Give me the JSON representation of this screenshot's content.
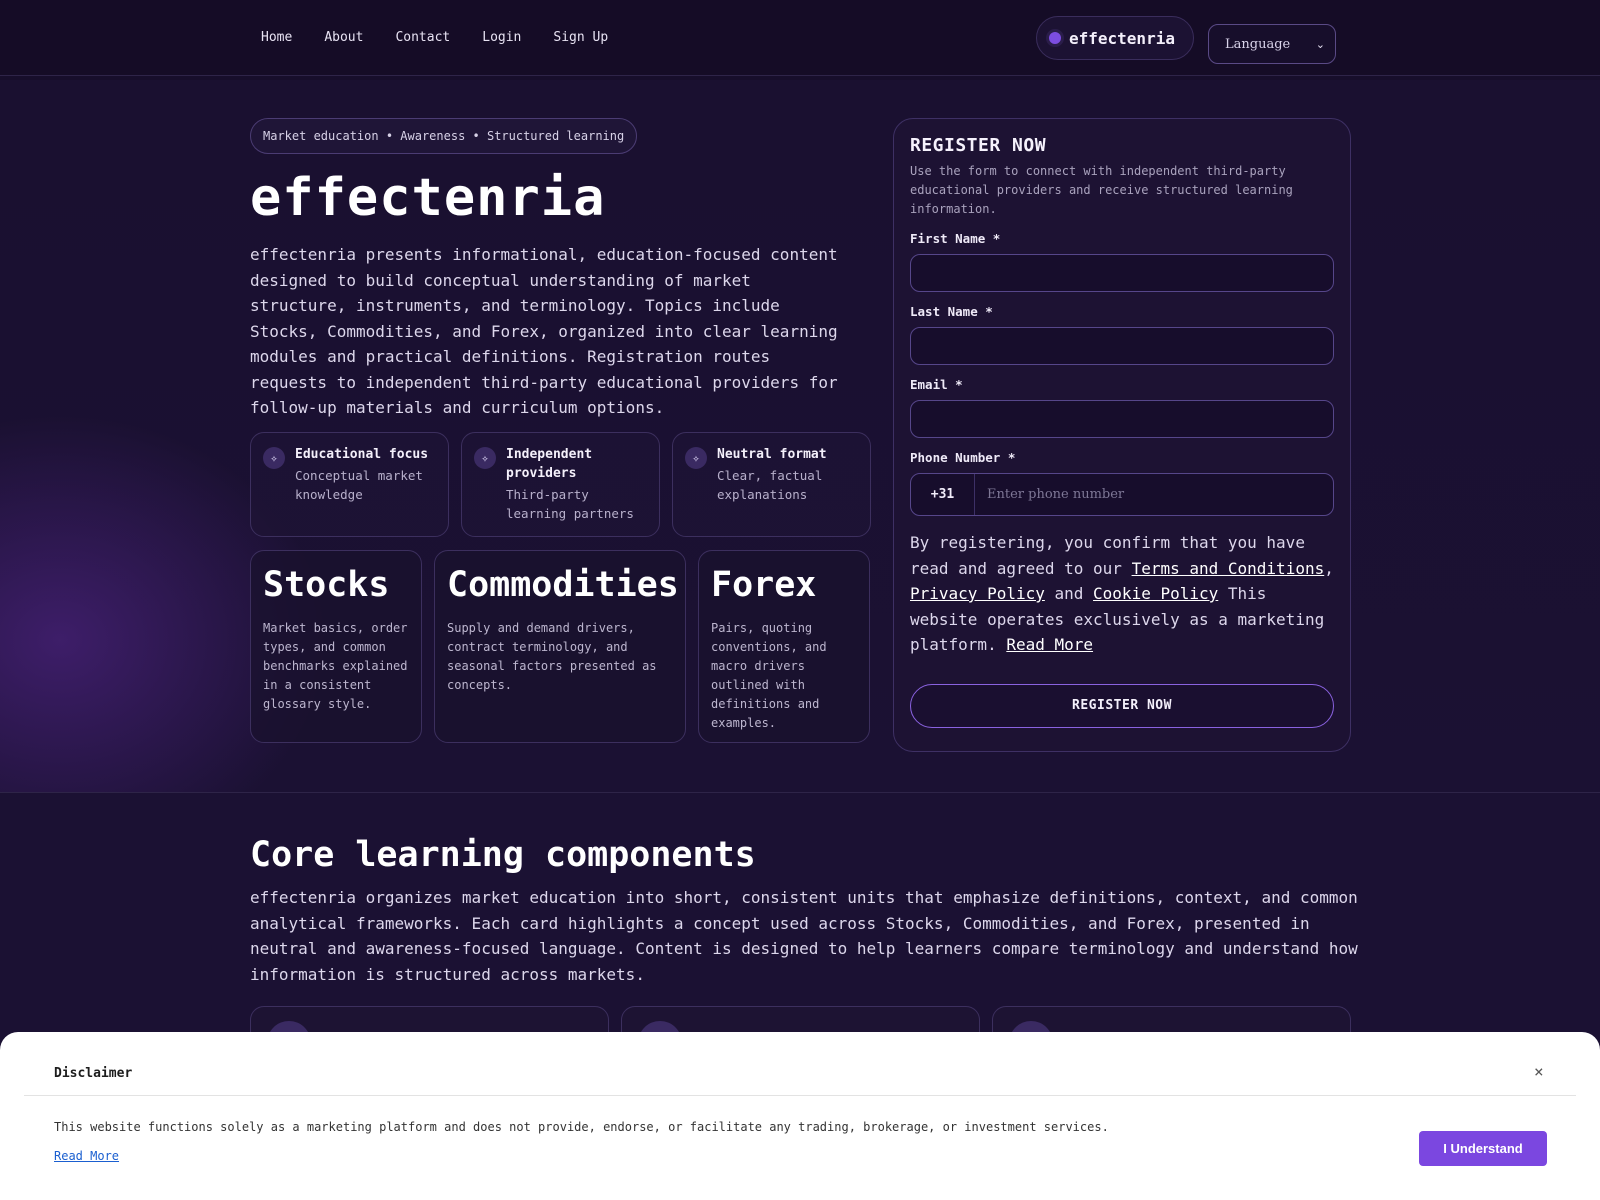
{
  "nav": {
    "links": [
      "Home",
      "About",
      "Contact",
      "Login",
      "Sign Up"
    ],
    "brand": "effectenria",
    "language_label": "Language"
  },
  "hero": {
    "tagline": "Market education • Awareness • Structured learning",
    "title": "effectenria",
    "description": "effectenria presents informational, education-focused content designed to build conceptual understanding of market structure, instruments, and terminology. Topics include Stocks, Commodities, and Forex, organized into clear learning modules and practical definitions. Registration routes requests to independent third-party educational providers for follow-up materials and curriculum options."
  },
  "features": [
    {
      "icon": "sparkle-icon",
      "title": "Educational focus",
      "subtitle": "Conceptual market knowledge"
    },
    {
      "icon": "sparkle-icon",
      "title": "Independent providers",
      "subtitle": "Third-party learning partners"
    },
    {
      "icon": "sparkle-icon",
      "title": "Neutral format",
      "subtitle": "Clear, factual explanations"
    }
  ],
  "markets": [
    {
      "title": "Stocks",
      "description": "Market basics, order types, and common benchmarks explained in a consistent glossary style."
    },
    {
      "title": "Commodities",
      "description": "Supply and demand drivers, contract terminology, and seasonal factors presented as concepts."
    },
    {
      "title": "Forex",
      "description": "Pairs, quoting conventions, and macro drivers outlined with definitions and examples."
    }
  ],
  "register": {
    "title": "REGISTER NOW",
    "subtitle": "Use the form to connect with independent third-party educational providers and receive structured learning information.",
    "first_name_label": "First Name *",
    "last_name_label": "Last Name *",
    "email_label": "Email *",
    "phone_label": "Phone Number *",
    "phone_code": "+31",
    "phone_placeholder": "Enter phone number",
    "consent_prefix": "By registering, you confirm that you have read and agreed to our ",
    "terms_link": "Terms and Conditions",
    "consent_comma": ", ",
    "privacy_link": "Privacy Policy",
    "consent_and": " and ",
    "cookie_link": "Cookie Policy",
    "consent_suffix": " This website operates exclusively as a marketing platform. ",
    "read_more_link": "Read More",
    "button_label": "REGISTER NOW"
  },
  "core": {
    "title": "Core learning components",
    "description": "effectenria organizes market education into short, consistent units that emphasize definitions, context, and common analytical frameworks. Each card highlights a concept used across Stocks, Commodities, and Forex, presented in neutral and awareness-focused language. Content is designed to help learners compare terminology and understand how information is structured across markets."
  },
  "disclaimer": {
    "title": "Disclaimer",
    "close": "×",
    "text": "This website functions solely as a marketing platform and does not provide, endorse, or facilitate any trading, brokerage, or investment services.",
    "read_more": "Read More",
    "button": "I Understand"
  },
  "colors": {
    "background": "#170e2b",
    "accent": "#7b47e0",
    "card_border": "#3c2f5e"
  }
}
